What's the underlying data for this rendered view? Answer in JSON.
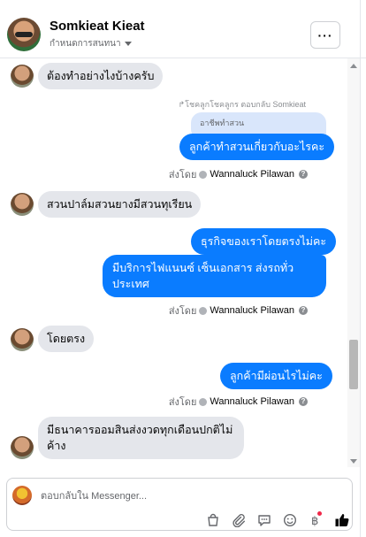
{
  "header": {
    "name": "Somkieat Kieat",
    "subtitle": "กำหนดการสนทนา",
    "more_label": "···"
  },
  "thread": {
    "msg1": "ต้องทำอย่างไงบ้างครับ",
    "reply_meta": "↱โชคลูกโชคลูกร ตอบกลับ Somkieat",
    "quoted_text": "อาชีพทำสวน",
    "msg2": "ลูกค้าทำสวนเกี่ยวกับอะไรคะ",
    "sent_prefix": "ส่งโดย",
    "sender": "Wannaluck Pilawan",
    "msg3": "สวนปาล์มสวนยางมีสวนทุเรียน",
    "msg4": "ธุรกิจของเราโดยตรงไม่คะ",
    "msg5_line1": "มีบริการไฟแนนซ์ เซ็นเอกสาร ส่งรถทั่ว",
    "msg5_line2": "ประเทศ",
    "msg6": "โดยตรง",
    "msg7": "ลูกค้ามีผ่อนไรไม่คะ",
    "msg8_line1": "มีธนาคารออมสินส่งงวดทุกเดือนปกติไม่",
    "msg8_line2": "ค้าง"
  },
  "composer": {
    "placeholder": "ตอบกลับใน Messenger...",
    "icons": [
      "shopping-bag-icon",
      "attachment-icon",
      "quick-reply-icon",
      "emoji-icon",
      "payment-icon",
      "like-icon"
    ]
  },
  "colors": {
    "outgoing_bubble": "#0a7cff",
    "incoming_bubble": "#e4e6eb",
    "quoted_bubble": "#d9e6fb"
  }
}
